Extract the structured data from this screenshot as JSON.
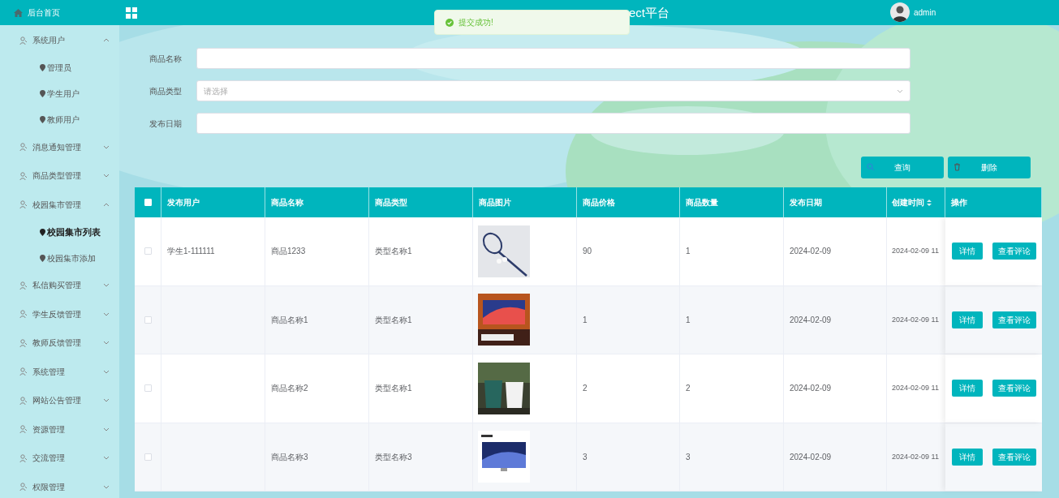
{
  "sidebar": {
    "home": "后台首页",
    "items": [
      {
        "label": "系统用户",
        "expanded": true,
        "children": [
          {
            "label": "管理员",
            "selected": false
          },
          {
            "label": "学生用户",
            "selected": false
          },
          {
            "label": "教师用户",
            "selected": false
          }
        ]
      },
      {
        "label": "消息通知管理",
        "expanded": false
      },
      {
        "label": "商品类型管理",
        "expanded": false
      },
      {
        "label": "校园集市管理",
        "expanded": true,
        "children": [
          {
            "label": "校园集市列表",
            "selected": true
          },
          {
            "label": "校园集市添加",
            "selected": false
          }
        ]
      },
      {
        "label": "私信购买管理",
        "expanded": false
      },
      {
        "label": "学生反馈管理",
        "expanded": false
      },
      {
        "label": "教师反馈管理",
        "expanded": false
      },
      {
        "label": "系统管理",
        "expanded": false
      },
      {
        "label": "网站公告管理",
        "expanded": false
      },
      {
        "label": "资源管理",
        "expanded": false
      },
      {
        "label": "交流管理",
        "expanded": false
      },
      {
        "label": "权限管理",
        "expanded": false
      }
    ]
  },
  "header": {
    "title": "ect平台",
    "user": "admin"
  },
  "toast": {
    "message": "提交成功!"
  },
  "search": {
    "fields": [
      {
        "label": "商品名称",
        "kind": "text"
      },
      {
        "label": "商品类型",
        "kind": "select",
        "placeholder": "请选择"
      },
      {
        "label": "发布日期",
        "kind": "text"
      }
    ],
    "buttons": [
      "查询",
      "删除"
    ]
  },
  "table": {
    "select_all_checked": false,
    "columns": [
      "发布用户",
      "商品名称",
      "商品类型",
      "商品图片",
      "商品价格",
      "商品数量",
      "发布日期",
      "创建时间",
      "操作"
    ],
    "rows": [
      {
        "checked": false,
        "user": "学生1-111111",
        "name": "商品1233",
        "type": "类型名称1",
        "picture": {
          "kind": "picture"
        },
        "price": "90",
        "qty": "1",
        "date": "2024-02-09",
        "created": "2024-02-09 11",
        "actions": [
          "详情",
          "查看评论"
        ]
      },
      {
        "checked": false,
        "name": "商品名称1",
        "type": "类型名称1",
        "picture": {
          "kind": "picture"
        },
        "price": "1",
        "qty": "1",
        "date": "2024-02-09",
        "created": "2024-02-09 11",
        "actions": [
          "详情",
          "查看评论"
        ]
      },
      {
        "checked": false,
        "name": "商品名称2",
        "type": "类型名称1",
        "picture": {
          "kind": "picture"
        },
        "price": "2",
        "qty": "2",
        "date": "2024-02-09",
        "created": "2024-02-09 11",
        "actions": [
          "详情",
          "查看评论"
        ]
      },
      {
        "checked": false,
        "name": "商品名称3",
        "type": "类型名称3",
        "picture": {
          "kind": "picture"
        },
        "price": "3",
        "qty": "3",
        "date": "2024-02-09",
        "created": "2024-02-09 11",
        "actions": [
          "详情",
          "查看评论"
        ]
      }
    ]
  }
}
